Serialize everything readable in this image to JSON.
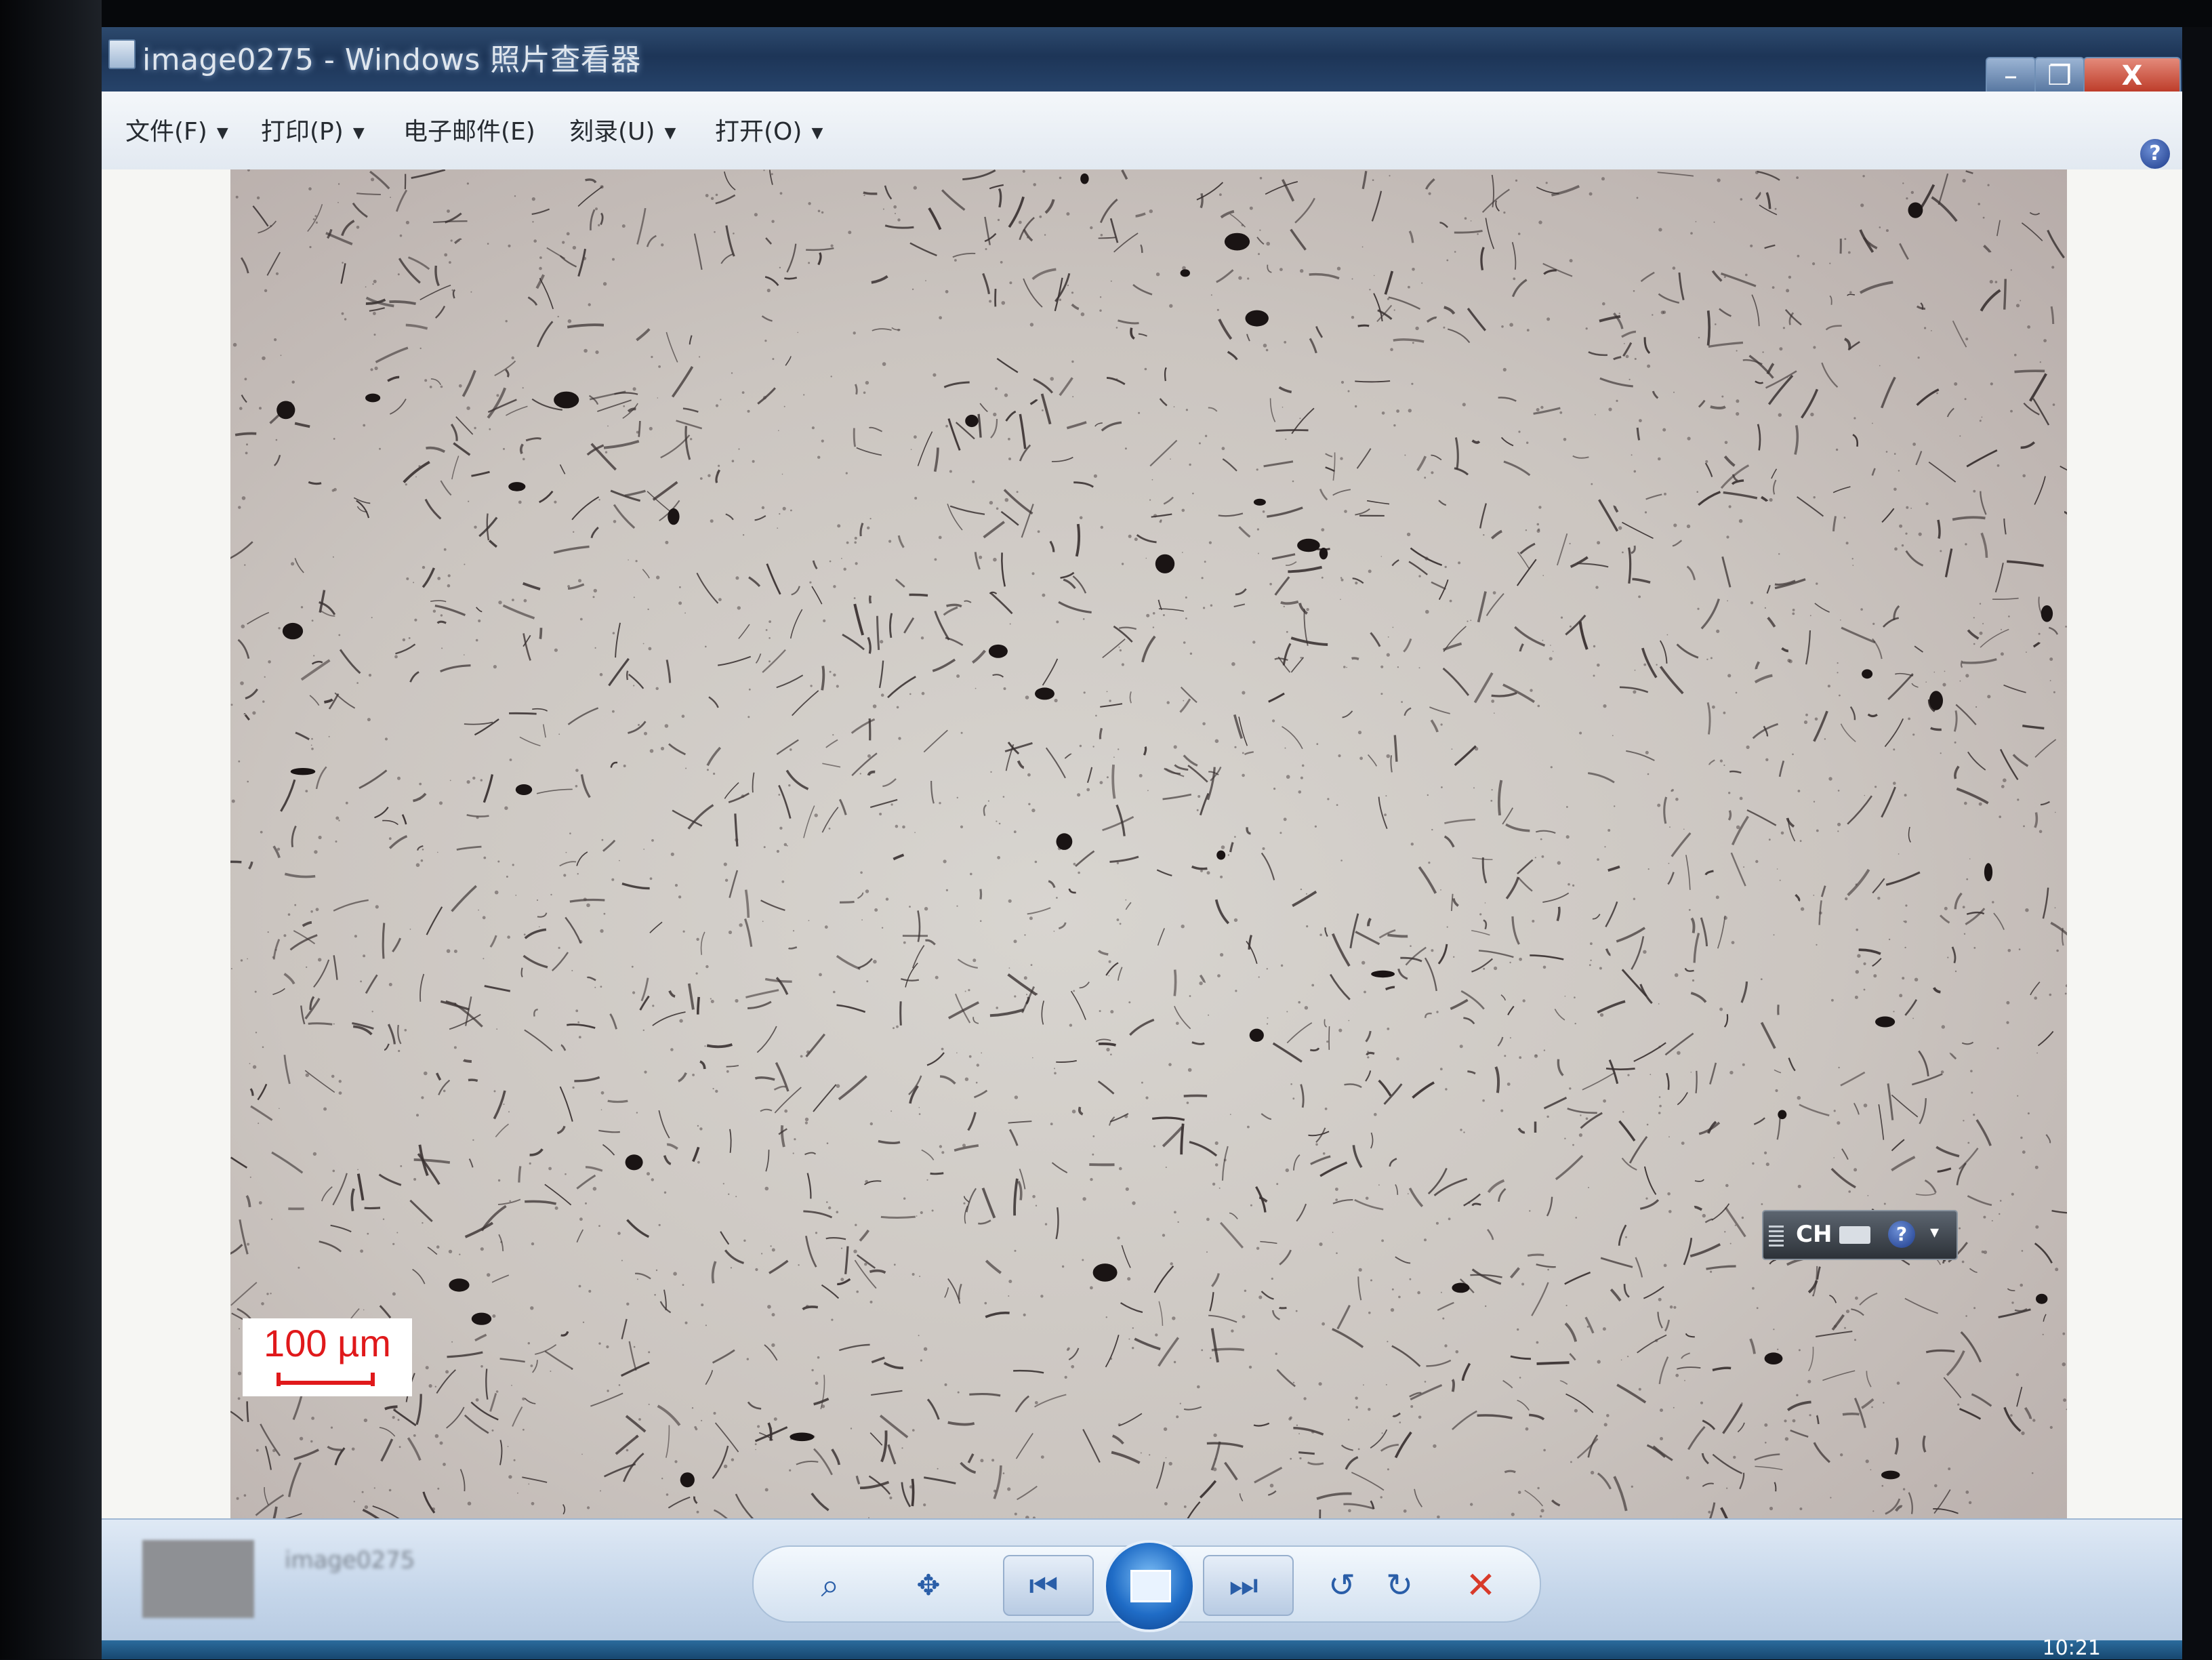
{
  "window": {
    "title": "image0275 - Windows 照片查看器",
    "controls": {
      "minimize": "–",
      "maximize": "❐",
      "close": "X"
    }
  },
  "menubar": {
    "items": [
      {
        "label": "文件(F)",
        "has_dropdown": true
      },
      {
        "label": "打印(P)",
        "has_dropdown": true
      },
      {
        "label": "电子邮件(E)",
        "has_dropdown": false
      },
      {
        "label": "刻录(U)",
        "has_dropdown": true
      },
      {
        "label": "打开(O)",
        "has_dropdown": true
      }
    ],
    "help_label": "?"
  },
  "image": {
    "scale_bar_label": "100 µm"
  },
  "ime_toolbar": {
    "language": "CH",
    "help_label": "?",
    "menu_glyph": "▾"
  },
  "navigation": {
    "thumbnail_caption_1": "image0275",
    "thumbnail_caption_2": "",
    "buttons": {
      "zoom": "zoom-icon",
      "actual_size": "actual-size-icon",
      "previous": "previous-icon",
      "slideshow": "slideshow-icon",
      "next": "next-icon",
      "rotate_ccw": "rotate-counterclockwise-icon",
      "rotate_cw": "rotate-clockwise-icon",
      "delete": "delete-icon"
    }
  },
  "taskbar": {
    "clock": "10:21"
  },
  "colors": {
    "scale_bar": "#e0191b",
    "title_bar": "#1d3557",
    "delete": "#d83a2a"
  }
}
